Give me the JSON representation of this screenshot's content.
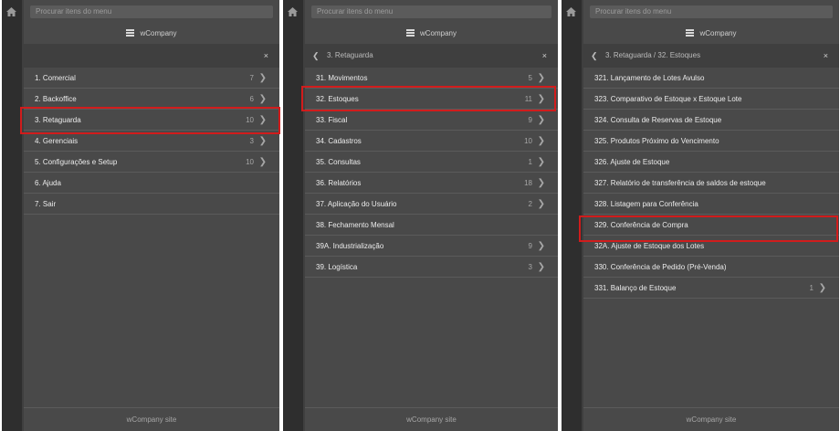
{
  "search_placeholder": "Procurar itens do menu",
  "brand": "wCompany",
  "footer": "wCompany site",
  "close": "×",
  "back": "❮",
  "chevron": "❯",
  "panel1": {
    "items": [
      {
        "label": "1. Comercial",
        "count": "7"
      },
      {
        "label": "2. Backoffice",
        "count": "6"
      },
      {
        "label": "3. Retaguarda",
        "count": "10"
      },
      {
        "label": "4. Gerenciais",
        "count": "3"
      },
      {
        "label": "5. Configurações e Setup",
        "count": "10"
      },
      {
        "label": "6. Ajuda",
        "count": ""
      },
      {
        "label": "7. Sair",
        "count": ""
      }
    ]
  },
  "panel2": {
    "breadcrumb": "3. Retaguarda",
    "items": [
      {
        "label": "31. Movimentos",
        "count": "5"
      },
      {
        "label": "32. Estoques",
        "count": "11"
      },
      {
        "label": "33. Fiscal",
        "count": "9"
      },
      {
        "label": "34. Cadastros",
        "count": "10"
      },
      {
        "label": "35. Consultas",
        "count": "1"
      },
      {
        "label": "36. Relatórios",
        "count": "18"
      },
      {
        "label": "37. Aplicação do Usuário",
        "count": "2"
      },
      {
        "label": "38. Fechamento Mensal",
        "count": ""
      },
      {
        "label": "39A. Industrialização",
        "count": "9"
      },
      {
        "label": "39. Logística",
        "count": "3"
      }
    ]
  },
  "panel3": {
    "breadcrumb": "3. Retaguarda  /  32. Estoques",
    "items": [
      {
        "label": "321. Lançamento de Lotes Avulso",
        "count": ""
      },
      {
        "label": "323. Comparativo de Estoque x Estoque Lote",
        "count": ""
      },
      {
        "label": "324. Consulta de Reservas de Estoque",
        "count": ""
      },
      {
        "label": "325. Produtos Próximo do Vencimento",
        "count": ""
      },
      {
        "label": "326. Ajuste de Estoque",
        "count": ""
      },
      {
        "label": "327. Relatório de transferência de saldos de estoque",
        "count": ""
      },
      {
        "label": "328. Listagem para Conferência",
        "count": ""
      },
      {
        "label": "329. Conferência de Compra",
        "count": ""
      },
      {
        "label": "32A. Ajuste de Estoque dos Lotes",
        "count": ""
      },
      {
        "label": "330. Conferência de Pedido (Pré-Venda)",
        "count": ""
      },
      {
        "label": "331. Balanço de Estoque",
        "count": "1"
      }
    ]
  },
  "highlight_color": "#d11c1c"
}
